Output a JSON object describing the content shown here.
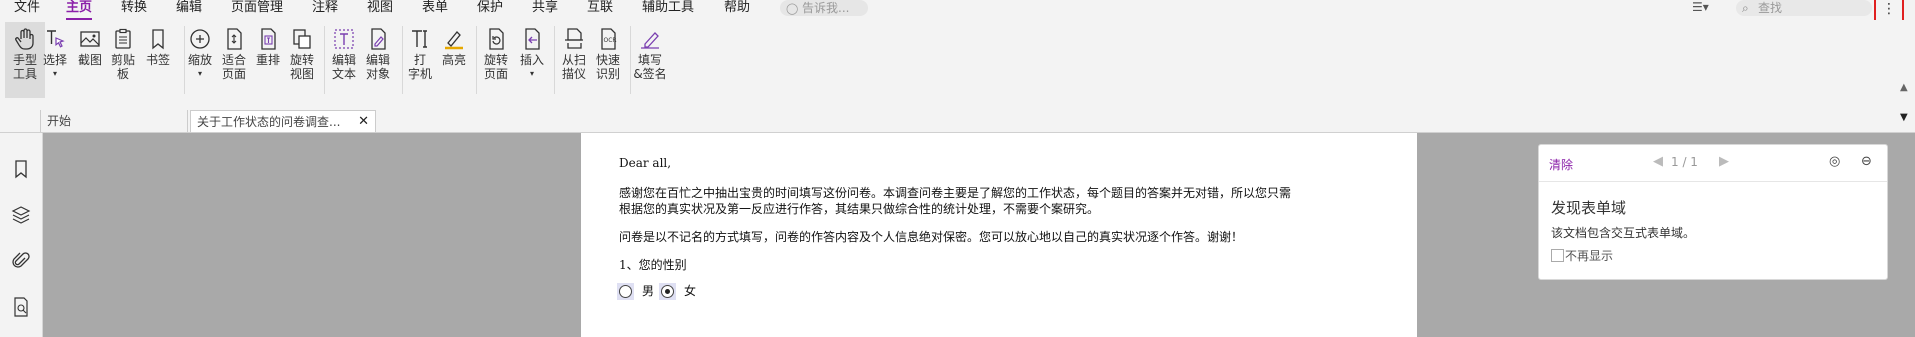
{
  "menu": {
    "items": [
      "文件",
      "主页",
      "转换",
      "编辑",
      "页面管理",
      "注释",
      "视图",
      "表单",
      "保护",
      "共享",
      "互联",
      "辅助工具",
      "帮助"
    ],
    "active": "主页",
    "tell_me_placeholder": "告诉我...",
    "search_placeholder": "查找"
  },
  "ribbon": {
    "tools": [
      {
        "label": "手型\n工具",
        "icon": "hand-icon"
      },
      {
        "label": "选择",
        "icon": "select-cursor-icon"
      },
      {
        "label": "截图",
        "icon": "snapshot-icon"
      },
      {
        "label": "剪贴\n板",
        "icon": "clipboard-icon"
      },
      {
        "label": "书签",
        "icon": "bookmark-icon"
      },
      {
        "label": "缩放",
        "icon": "zoom-icon"
      },
      {
        "label": "适合\n页面",
        "icon": "fit-page-icon"
      },
      {
        "label": "重排",
        "icon": "reflow-icon"
      },
      {
        "label": "旋转\n视图",
        "icon": "rotate-view-icon"
      },
      {
        "label": "编辑\n文本",
        "icon": "edit-text-icon"
      },
      {
        "label": "编辑\n对象",
        "icon": "edit-object-icon"
      },
      {
        "label": "打\n字机",
        "icon": "typewriter-icon"
      },
      {
        "label": "高亮",
        "icon": "highlight-icon"
      },
      {
        "label": "旋转\n页面",
        "icon": "rotate-page-icon"
      },
      {
        "label": "插入",
        "icon": "insert-icon"
      },
      {
        "label": "从扫\n描仪",
        "icon": "scanner-icon"
      },
      {
        "label": "快速\n识别",
        "icon": "ocr-icon"
      },
      {
        "label": "填写\n&签名",
        "icon": "fill-sign-icon"
      }
    ]
  },
  "tabs": {
    "home": "开始",
    "doc": "关于工作状态的问卷调查..."
  },
  "document": {
    "greeting": "Dear all,",
    "p1_line1": "感谢您在百忙之中抽出宝贵的时间填写这份问卷。本调查问卷主要是了解您的工作状态，每个题目的答案并无对错，所以您只需",
    "p1_line2": "根据您的真实状况及第一反应进行作答，其结果只做综合性的统计处理，不需要个案研究。",
    "p2": "问卷是以不记名的方式填写，问卷的作答内容及个人信息绝对保密。您可以放心地以自己的真实状况逐个作答。谢谢！",
    "q1": "1、您的性别",
    "option_male": "男",
    "option_female": "女",
    "selected": "女"
  },
  "form_panel": {
    "clear_label": "清除",
    "pager": "1 / 1",
    "title": "发现表单域",
    "description": "该文档包含交互式表单域。",
    "dont_show_label": "不再显示"
  },
  "colors": {
    "accent": "#8a1fa8",
    "highlight_border": "#e02020",
    "doc_background": "#a9a9a9"
  }
}
